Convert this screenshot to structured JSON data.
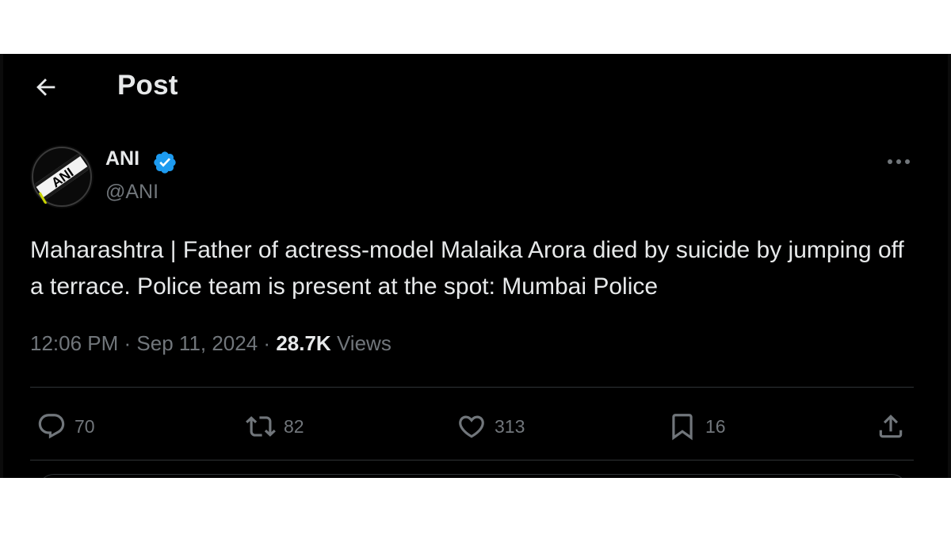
{
  "header": {
    "title": "Post",
    "back_icon": "arrow-left-icon"
  },
  "author": {
    "name": "ANI",
    "handle": "@ANI",
    "verified_icon": "verified-badge-icon",
    "avatar_text": "ANI",
    "verified_color": "#1d9bf0"
  },
  "post": {
    "text": "Maharashtra | Father of actress-model Malaika Arora died by suicide by jumping off a terrace. Police team is present at the spot: Mumbai Police",
    "time": "12:06 PM",
    "date": "Sep 11, 2024",
    "views_count": "28.7K",
    "views_label": "Views"
  },
  "actions": {
    "replies": "70",
    "reposts": "82",
    "likes": "313",
    "bookmarks": "16"
  },
  "colors": {
    "background": "#000000",
    "text_primary": "#e7e9ea",
    "text_secondary": "#71767b",
    "divider": "#2f3336"
  }
}
